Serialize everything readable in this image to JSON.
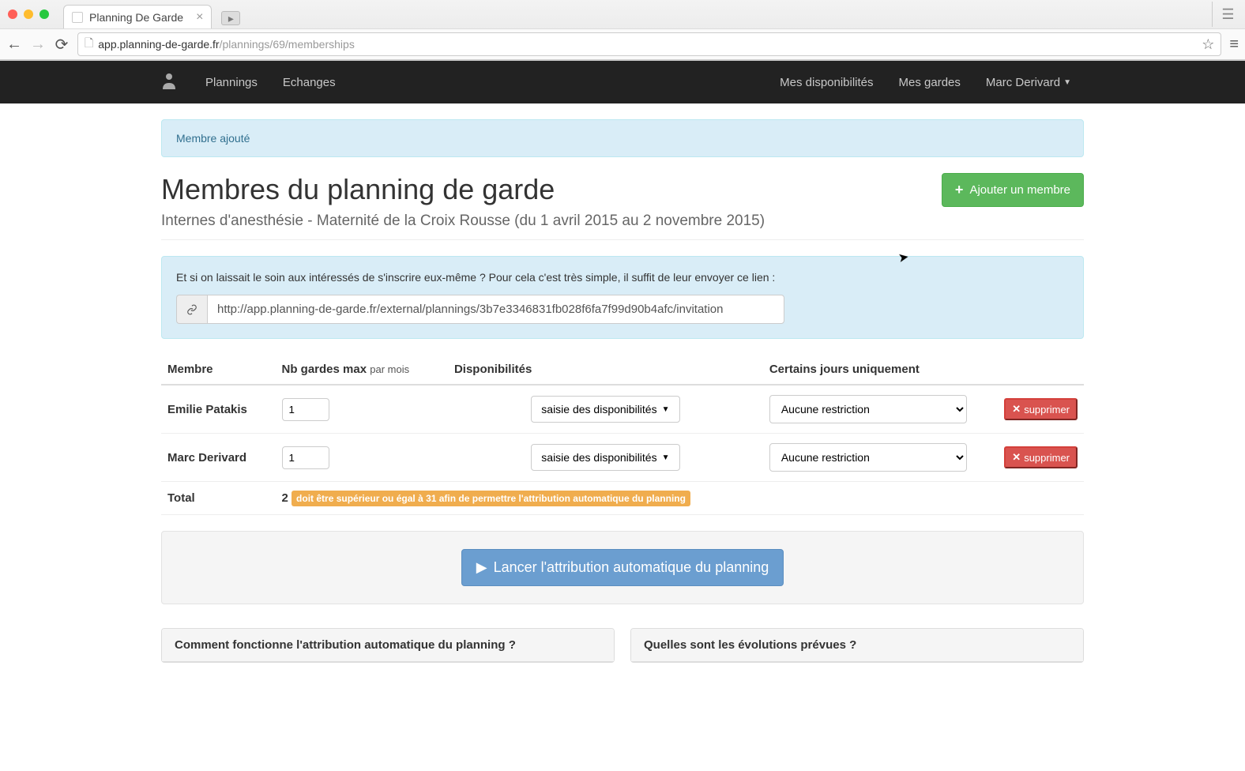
{
  "browser": {
    "tab_title": "Planning De Garde",
    "url_domain": "app.planning-de-garde.fr",
    "url_path": "/plannings/69/memberships"
  },
  "nav": {
    "plannings": "Plannings",
    "echanges": "Echanges",
    "disponibilites": "Mes disponibilités",
    "gardes": "Mes gardes",
    "username": "Marc Derivard"
  },
  "flash": {
    "message": "Membre ajouté"
  },
  "header": {
    "title": "Membres du planning de garde",
    "subtitle": "Internes d'anesthésie - Maternité de la Croix Rousse (du 1 avril 2015 au 2 novembre 2015)",
    "add_button": "Ajouter un membre"
  },
  "invite": {
    "intro": "Et si on laissait le soin aux intéressés de s'inscrire eux-même ? Pour cela c'est très simple, il suffit de leur envoyer ce lien :",
    "url": "http://app.planning-de-garde.fr/external/plannings/3b7e3346831fb028f6fa7f99d90b4afc/invitation"
  },
  "table": {
    "col_member": "Membre",
    "col_max": "Nb gardes max",
    "col_max_suffix": "par mois",
    "col_dispo": "Disponibilités",
    "col_days": "Certains jours uniquement",
    "dispo_label": "saisie des disponibilités",
    "restriction_none": "Aucune restriction",
    "delete_label": "supprimer",
    "total_label": "Total",
    "total_value": "2",
    "total_warning": "doit être supérieur ou égal à 31 afin de permettre l'attribution automatique du planning",
    "rows": [
      {
        "name": "Emilie Patakis",
        "max": "1"
      },
      {
        "name": "Marc Derivard",
        "max": "1"
      }
    ]
  },
  "launch": {
    "button": "Lancer l'attribution automatique du planning"
  },
  "faq": {
    "q1": "Comment fonctionne l'attribution automatique du planning ?",
    "q2": "Quelles sont les évolutions prévues ?"
  }
}
